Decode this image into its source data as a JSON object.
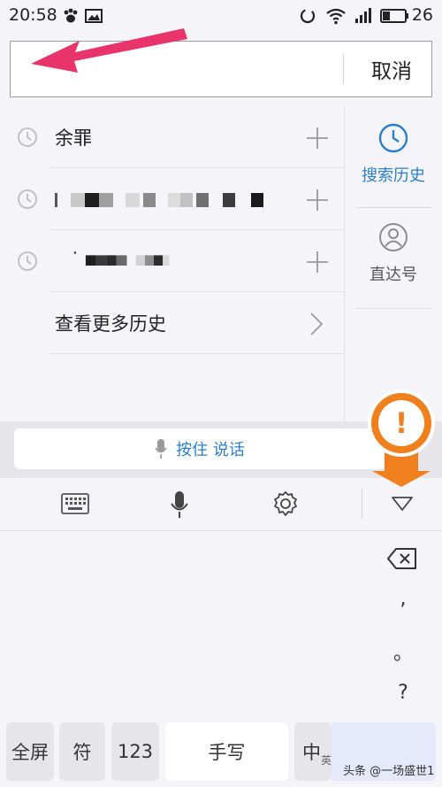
{
  "status": {
    "time": "20:58",
    "battery": "26"
  },
  "search": {
    "value": "",
    "placeholder": "",
    "cancel_label": "取消"
  },
  "history": {
    "items": [
      {
        "label": "余罪"
      },
      {
        "label": ""
      },
      {
        "label": ""
      }
    ],
    "more_label": "查看更多历史"
  },
  "side": {
    "tabs": [
      {
        "label": "搜索历史",
        "icon": "clock-icon",
        "active": true
      },
      {
        "label": "直达号",
        "icon": "person-icon",
        "active": false
      }
    ]
  },
  "voice": {
    "label": "按住 说话"
  },
  "keyboard": {
    "punct": [
      ",",
      "。",
      "?"
    ],
    "keys": {
      "fullscreen": "全屏",
      "symbol": "符",
      "num": "123",
      "handwrite": "手写",
      "cn": "中",
      "cn_sub": "英"
    }
  },
  "badge": {
    "symbol": "!"
  },
  "watermark": "头条 @一场盛世1",
  "colors": {
    "accent": "#2a7fd0",
    "badge": "#f07f1d",
    "arrow": "#e8336b"
  }
}
